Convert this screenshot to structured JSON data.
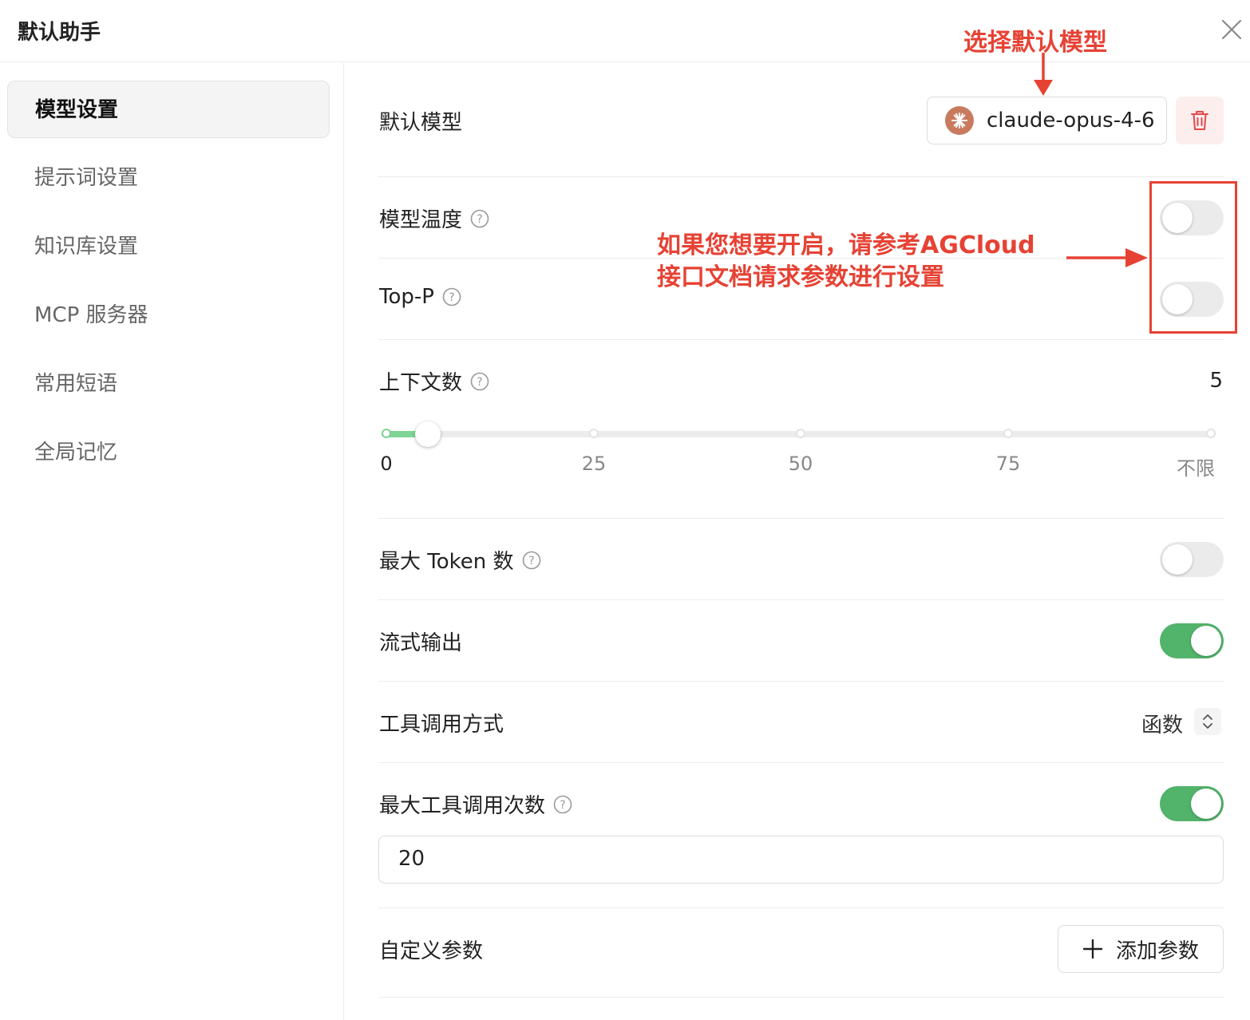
{
  "window": {
    "title": "默认助手"
  },
  "sidebar": {
    "items": [
      {
        "label": "模型设置"
      },
      {
        "label": "提示词设置"
      },
      {
        "label": "知识库设置"
      },
      {
        "label": "MCP 服务器"
      },
      {
        "label": "常用短语"
      },
      {
        "label": "全局记忆"
      }
    ],
    "active_index": 0
  },
  "settings": {
    "default_model": {
      "label": "默认模型",
      "value": "claude-opus-4-6"
    },
    "temperature": {
      "label": "模型温度",
      "enabled": false
    },
    "top_p": {
      "label": "Top-P",
      "enabled": false
    },
    "context_count": {
      "label": "上下文数",
      "value": "5",
      "ticks": [
        "0",
        "25",
        "50",
        "75",
        "不限"
      ]
    },
    "max_tokens": {
      "label": "最大 Token 数",
      "enabled": false
    },
    "stream_output": {
      "label": "流式输出",
      "enabled": true
    },
    "tool_call_mode": {
      "label": "工具调用方式",
      "value": "函数"
    },
    "max_tool_calls": {
      "label": "最大工具调用次数",
      "enabled": true,
      "value": "20"
    },
    "custom_params": {
      "label": "自定义参数",
      "add_button": "添加参数"
    }
  },
  "annotations": {
    "select_model": "选择默认模型",
    "enable_hint_line1": "如果您想要开启，请参考AGCloud",
    "enable_hint_line2": "接口文档请求参数进行设置"
  },
  "colors": {
    "accent_green": "#52b36a",
    "slider_fill": "#7ed494",
    "annotation_red": "#e64234",
    "delete_bg": "#fdeeee"
  }
}
